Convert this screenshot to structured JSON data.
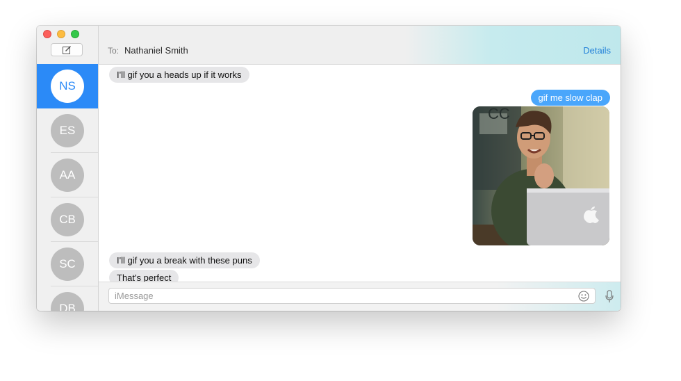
{
  "window": {
    "traffic_lights": {
      "close": "#fc605c",
      "minimize": "#fdbc40",
      "maximize": "#34c84a"
    }
  },
  "sidebar": {
    "compose_icon": "compose-icon",
    "conversations": [
      {
        "initials": "NS",
        "selected": true
      },
      {
        "initials": "ES",
        "selected": false
      },
      {
        "initials": "AA",
        "selected": false
      },
      {
        "initials": "CB",
        "selected": false
      },
      {
        "initials": "SC",
        "selected": false
      },
      {
        "initials": "DB",
        "selected": false
      }
    ]
  },
  "header": {
    "to_label": "To:",
    "recipient": "Nathaniel Smith",
    "details_label": "Details"
  },
  "messages": [
    {
      "direction": "incoming",
      "text": "I'll gif you a heads up if it works"
    },
    {
      "direction": "outgoing",
      "text": "gif me slow clap"
    },
    {
      "direction": "outgoing",
      "type": "image",
      "image_icon": "slow-clap-gif"
    },
    {
      "direction": "incoming",
      "text": "I'll gif you a break with these puns"
    },
    {
      "direction": "incoming",
      "text": "That's perfect"
    }
  ],
  "input": {
    "placeholder": "iMessage",
    "value": "",
    "emoji_icon": "emoji-icon",
    "mic_icon": "microphone-icon"
  },
  "colors": {
    "selected_blue": "#2b8af7",
    "outgoing_bubble": "#4aa6fb",
    "incoming_bubble": "#e6e6e8",
    "link_blue": "#1f7fd8"
  }
}
